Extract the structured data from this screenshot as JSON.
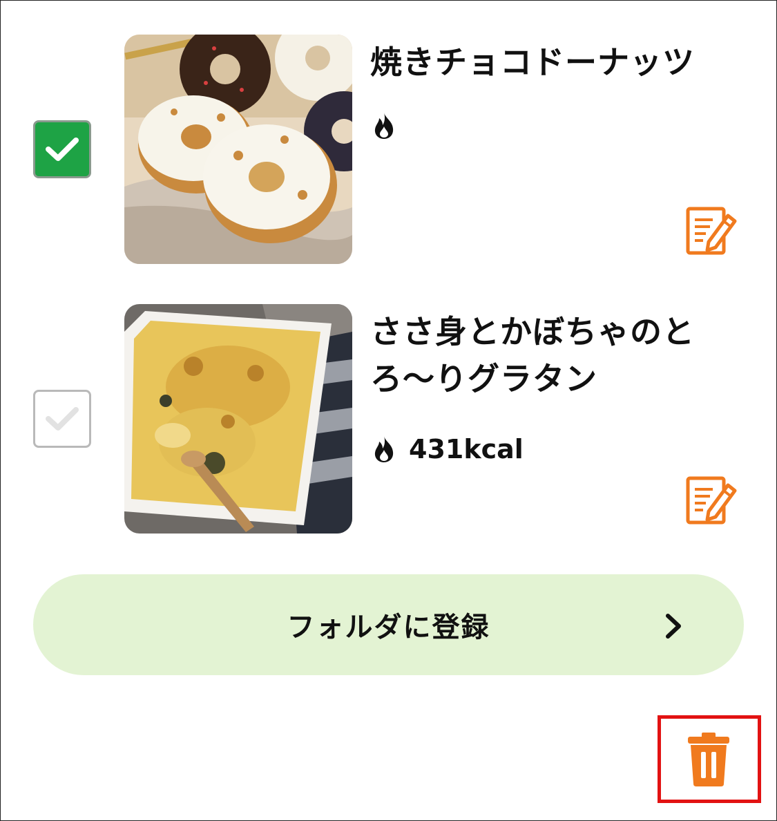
{
  "recipes": [
    {
      "title": "焼きチョコドーナッツ",
      "calories": "",
      "checked": true,
      "image": "chocolate-donuts-photo"
    },
    {
      "title": "ささ身とかぼちゃのとろ〜りグラタン",
      "calories": "431kcal",
      "checked": false,
      "image": "chicken-pumpkin-gratin-photo"
    }
  ],
  "folder_button": {
    "label": "フォルダに登録"
  },
  "icons": {
    "flame": "flame-icon",
    "memo": "memo-edit-icon",
    "trash": "trash-icon",
    "chevron": "chevron-right-icon",
    "check": "checkmark-icon"
  },
  "colors": {
    "checked_green": "#1ea345",
    "accent_orange": "#f07a1e",
    "folder_button_bg": "#e3f3d3",
    "highlight_red": "#e21212"
  }
}
